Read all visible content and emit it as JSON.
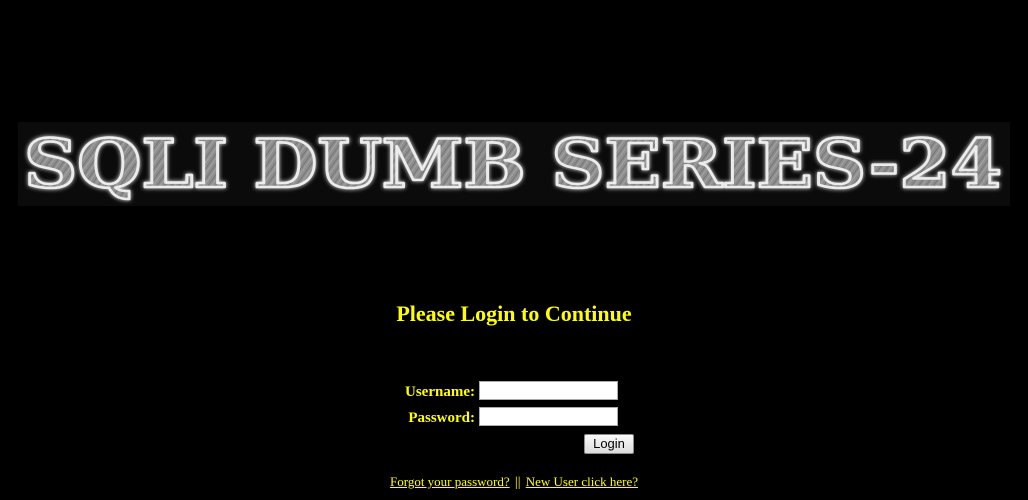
{
  "banner": {
    "text": "SQLI DUMB SERIES-24"
  },
  "login": {
    "title": "Please Login to Continue",
    "username_label": "Username:",
    "username_value": "",
    "password_label": "Password:",
    "password_value": "",
    "submit_label": "Login"
  },
  "links": {
    "forgot_password": "Forgot your password?",
    "separator": "||",
    "new_user": "New User click here?"
  },
  "colors": {
    "background": "#000000",
    "accent_text": "#ffff00",
    "banner_letter_fill": "#8a8a8a",
    "banner_letter_stroke": "#e8e8e8"
  }
}
